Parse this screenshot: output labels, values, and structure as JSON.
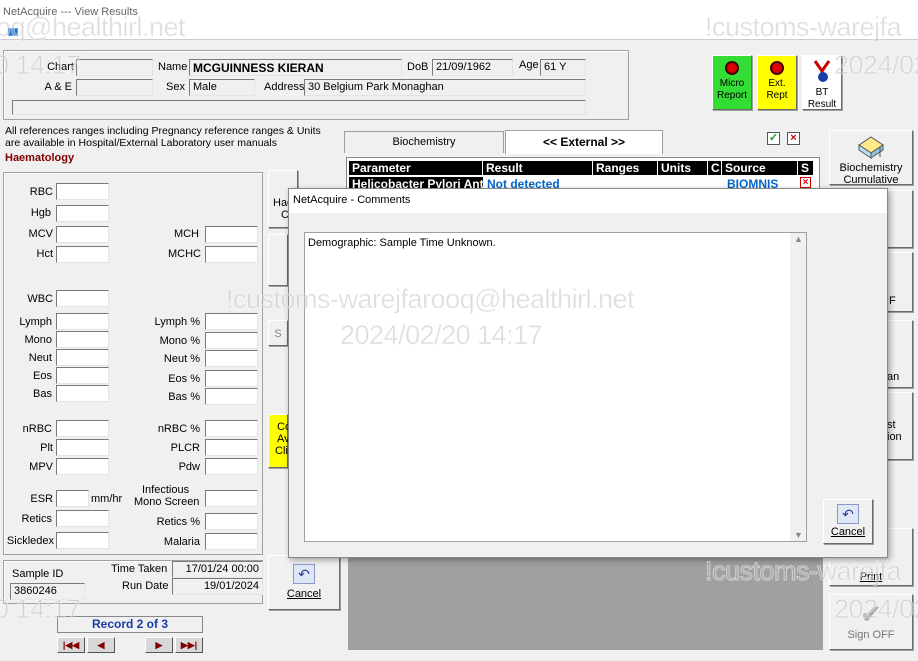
{
  "window": {
    "title": "NetAcquire --- View Results"
  },
  "patient": {
    "chart_label": "Chart",
    "chart_value": "",
    "ae_label": "A & E",
    "ae_value": "",
    "name_label": "Name",
    "name_value": "MCGUINNESS KIERAN",
    "sex_label": "Sex",
    "sex_value": "Male",
    "dob_label": "DoB",
    "dob_value": "21/09/1962",
    "age_label": "Age",
    "age_value": "61 Y",
    "address_label": "Address",
    "address_value": "30 Belgium Park Monaghan"
  },
  "toolbar": {
    "micro_label": "Micro Report",
    "ext_label": "Ext. Rept",
    "bt_label": "BT Result",
    "biochem_cumulative_label": "Biochemistry Cumulative"
  },
  "info": {
    "references_note": "All references ranges including Pregnancy reference ranges & Units are available in Hospital/External Laboratory user manuals",
    "section_title": "Haematology"
  },
  "haem": {
    "rbc": "RBC",
    "hgb": "Hgb",
    "mcv": "MCV",
    "hct": "Hct",
    "mch": "MCH",
    "mchc": "MCHC",
    "wbc": "WBC",
    "lymph": "Lymph",
    "mono": "Mono",
    "neut": "Neut",
    "eos": "Eos",
    "bas": "Bas",
    "lymph_pct": "Lymph %",
    "mono_pct": "Mono %",
    "neut_pct": "Neut %",
    "eos_pct": "Eos %",
    "bas_pct": "Bas %",
    "nrbc": "nRBC",
    "plt": "Plt",
    "mpv": "MPV",
    "nrbc_pct": "nRBC %",
    "plcr": "PLCR",
    "pdw": "Pdw",
    "esr": "ESR",
    "esr_unit": "mm/hr",
    "retics": "Retics",
    "sickledex": "Sickledex",
    "infectious_line1": "Infectious",
    "infectious_line2": "Mono Screen",
    "retics_pct": "Retics %",
    "malaria": "Malaria"
  },
  "sample": {
    "id_label": "Sample ID",
    "id_value": "3860246",
    "time_taken_label": "Time Taken",
    "time_taken_value": "17/01/24 00:00",
    "run_date_label": "Run Date",
    "run_date_value": "19/01/2024",
    "record_text": "Record 2 of 3"
  },
  "tabs": {
    "biochemistry": "Biochemistry",
    "external": "<< External >>"
  },
  "results_table": {
    "headers": [
      "Parameter",
      "Result",
      "Ranges",
      "Units",
      "C",
      "Source",
      "S"
    ],
    "rows": [
      {
        "parameter": "Helicobacter Pylori Ant",
        "result": "Not detected",
        "ranges": "",
        "units": "",
        "c": "",
        "source": "BIOMNIS",
        "s": "×"
      }
    ]
  },
  "partial_buttons": {
    "haem_cumul_line1": "Hae",
    "haem_cumul_line2": "Cu",
    "s_label": "S",
    "yellow_line1": "Co",
    "yellow_line2": "Av",
    "yellow_line3": "Cli",
    "cancel_label": "Cancel",
    "right_f": "F",
    "right_an": "an",
    "right_st": "st",
    "right_ion": "ion",
    "print_label": "Print",
    "signoff_label": "Sign OFF"
  },
  "dialog": {
    "title": "NetAcquire - Comments",
    "comment_text": "Demographic: Sample Time Unknown.",
    "cancel_label": "Cancel"
  },
  "watermark": {
    "text_a": "!customs-warejfarooq@healthirl.net",
    "text_b": "2024/02/20 14:17",
    "text_c": "oq@healthirl.net",
    "text_d": "!customs-warejfa",
    "text_e": "0 14:17",
    "text_f": "2024/02"
  },
  "colors": {
    "micro_bg": "#33dd33",
    "ext_bg": "#ffff00",
    "section_red": "#800000",
    "link_blue": "#0066cc",
    "record_blue": "#0000aa"
  }
}
